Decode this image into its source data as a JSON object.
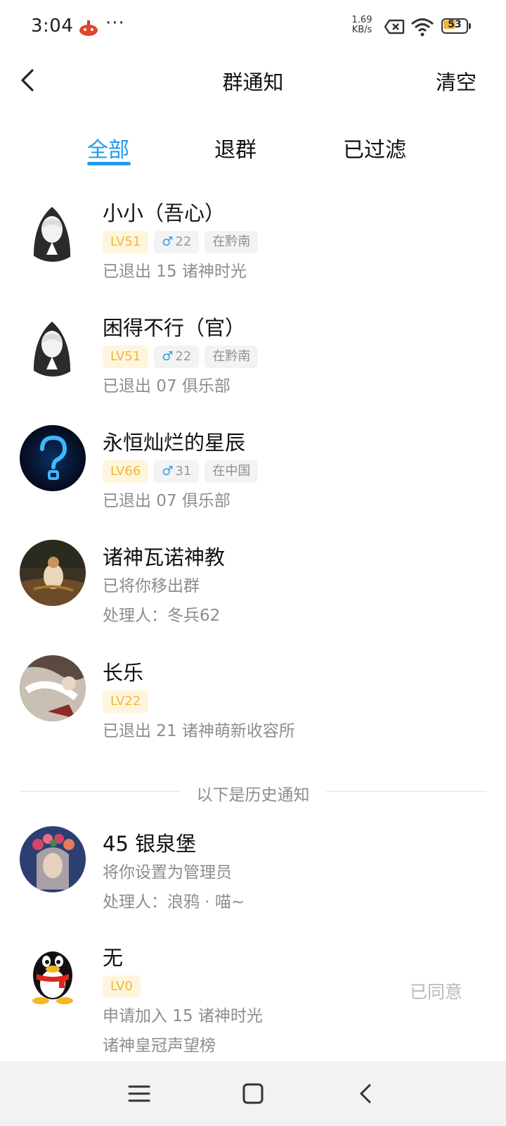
{
  "status_bar": {
    "time": "3:04",
    "dots": "···",
    "net_speed_value": "1.69",
    "net_speed_unit": "KB/s",
    "battery": "53",
    "battery_level": 0.53
  },
  "header": {
    "title": "群通知",
    "clear_label": "清空"
  },
  "tabs": [
    {
      "label": "全部",
      "active": true
    },
    {
      "label": "退群",
      "active": false
    },
    {
      "label": "已过滤",
      "active": false
    }
  ],
  "notifications": [
    {
      "name": "小小（吾心）",
      "level": "LV51",
      "gender_symbol": "♂",
      "age": "22",
      "location": "在黔南",
      "line1": "已退出 15 诸神时光"
    },
    {
      "name": "困得不行（官）",
      "level": "LV51",
      "gender_symbol": "♂",
      "age": "22",
      "location": "在黔南",
      "line1": "已退出 07 俱乐部"
    },
    {
      "name": "永恒灿烂的星辰",
      "level": "LV66",
      "gender_symbol": "♂",
      "age": "31",
      "location": "在中国",
      "line1": "已退出 07 俱乐部"
    },
    {
      "name": "诸神瓦诺神教",
      "line1": "已将你移出群",
      "line2": "处理人：冬兵62"
    },
    {
      "name": "长乐",
      "level": "LV22",
      "line1": "已退出 21 诸神萌新收容所"
    }
  ],
  "history_divider": "以下是历史通知",
  "history": [
    {
      "name": "45 银泉堡",
      "line1": "将你设置为管理员",
      "line2": "处理人：浪鸦 · 喵~"
    },
    {
      "name": "无",
      "level": "LV0",
      "line1": "申请加入 15 诸神时光",
      "line2": "诸神皇冠声望榜",
      "status": "已同意"
    }
  ]
}
